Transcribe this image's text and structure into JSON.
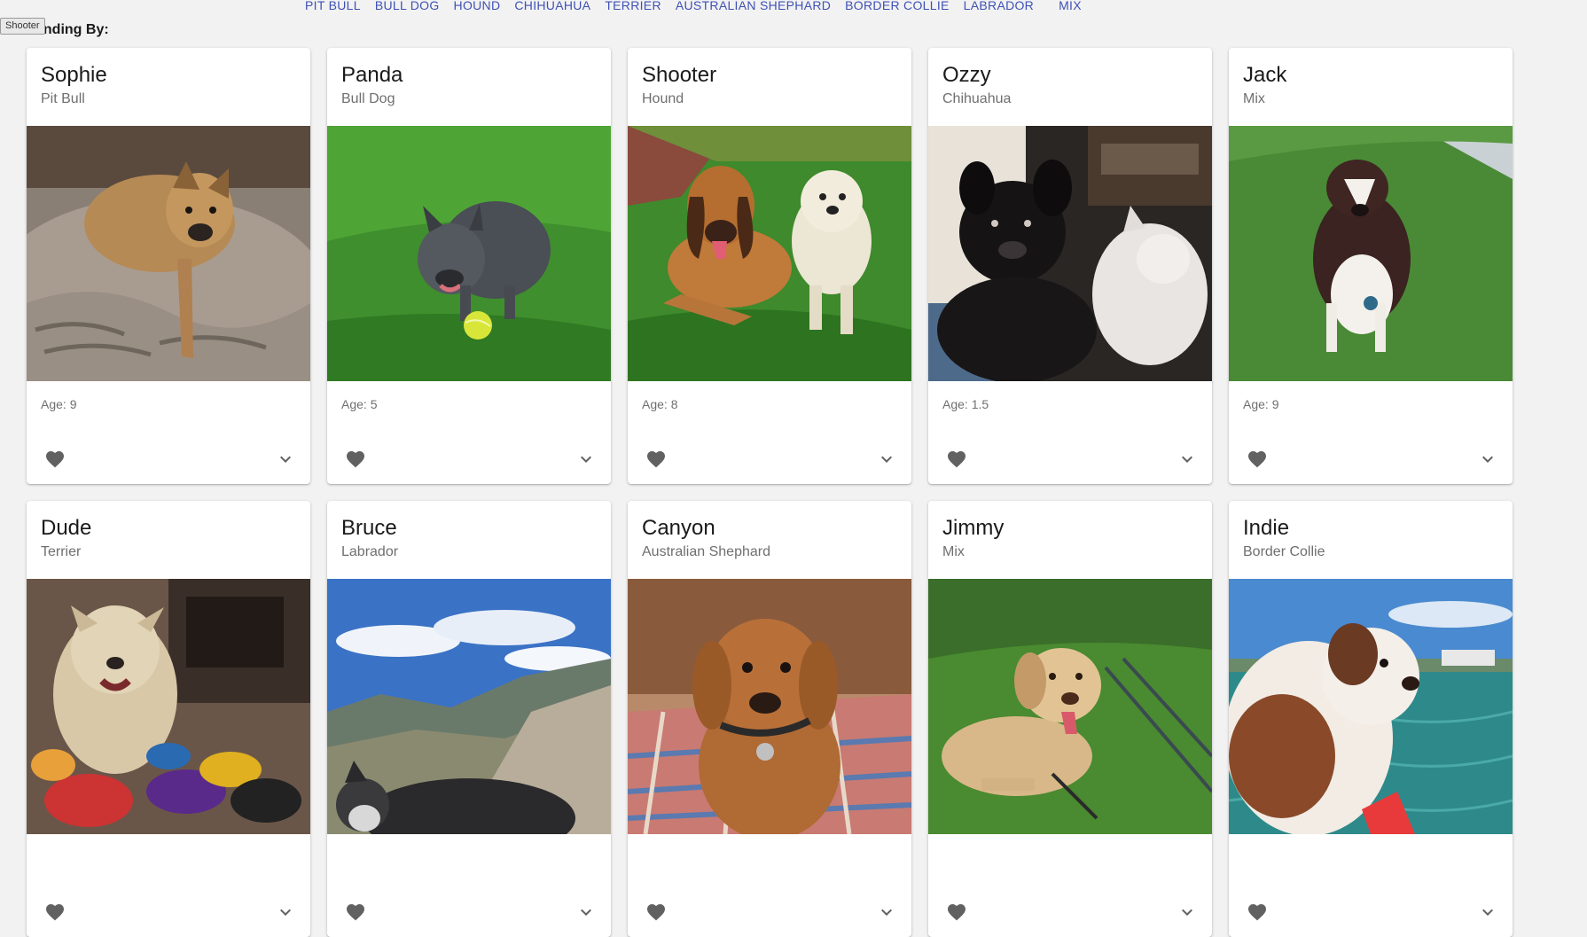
{
  "tooltip": "Shooter",
  "filters": [
    "PIT BULL",
    "BULL DOG",
    "HOUND",
    "CHIHUAHUA",
    "TERRIER",
    "AUSTRALIAN SHEPHARD",
    "BORDER COLLIE",
    "LABRADOR",
    "MIX"
  ],
  "section_heading": "Standing By:",
  "age_prefix": "Age: ",
  "dogs": [
    {
      "name": "Sophie",
      "breed": "Pit Bull",
      "age": "Age: 9"
    },
    {
      "name": "Panda",
      "breed": "Bull Dog",
      "age": "Age: 5"
    },
    {
      "name": "Shooter",
      "breed": "Hound",
      "age": "Age: 8"
    },
    {
      "name": "Ozzy",
      "breed": "Chihuahua",
      "age": "Age: 1.5"
    },
    {
      "name": "Jack",
      "breed": "Mix",
      "age": "Age: 9"
    },
    {
      "name": "Dude",
      "breed": "Terrier",
      "age": ""
    },
    {
      "name": "Bruce",
      "breed": "Labrador",
      "age": ""
    },
    {
      "name": "Canyon",
      "breed": "Australian Shephard",
      "age": ""
    },
    {
      "name": "Jimmy",
      "breed": "Mix",
      "age": ""
    },
    {
      "name": "Indie",
      "breed": "Border Collie",
      "age": ""
    }
  ],
  "icons": {
    "favorite": "heart-icon",
    "expand": "chevron-down-icon"
  },
  "colors": {
    "link": "#3f51b5",
    "background": "#f2f2f2",
    "icon": "#616161"
  }
}
